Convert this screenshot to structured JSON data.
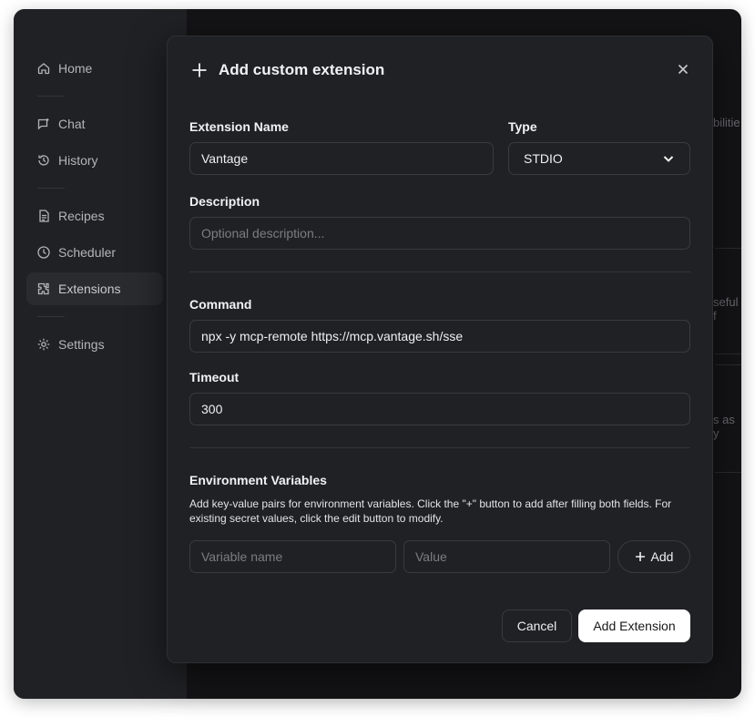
{
  "sidebar": {
    "items": [
      {
        "label": "Home",
        "icon": "home-icon"
      },
      {
        "label": "Chat",
        "icon": "chat-icon"
      },
      {
        "label": "History",
        "icon": "history-icon"
      },
      {
        "label": "Recipes",
        "icon": "recipe-icon"
      },
      {
        "label": "Scheduler",
        "icon": "clock-icon"
      },
      {
        "label": "Extensions",
        "icon": "puzzle-icon",
        "active": true
      },
      {
        "label": "Settings",
        "icon": "gear-icon"
      }
    ]
  },
  "background": {
    "snippet_1": "bilitie",
    "snippet_2": "seful f",
    "snippet_3": "s as y"
  },
  "modal": {
    "title": "Add custom extension",
    "name_label": "Extension Name",
    "name_value": "Vantage",
    "type_label": "Type",
    "type_value": "STDIO",
    "description_label": "Description",
    "description_placeholder": "Optional description...",
    "command_label": "Command",
    "command_value": "npx -y mcp-remote https://mcp.vantage.sh/sse",
    "timeout_label": "Timeout",
    "timeout_value": "300",
    "env_title": "Environment Variables",
    "env_help": "Add key-value pairs for environment variables. Click the \"+\" button to add after filling both fields. For existing secret values, click the edit button to modify.",
    "var_name_placeholder": "Variable name",
    "var_value_placeholder": "Value",
    "add_label": "Add",
    "cancel_label": "Cancel",
    "submit_label": "Add Extension"
  }
}
